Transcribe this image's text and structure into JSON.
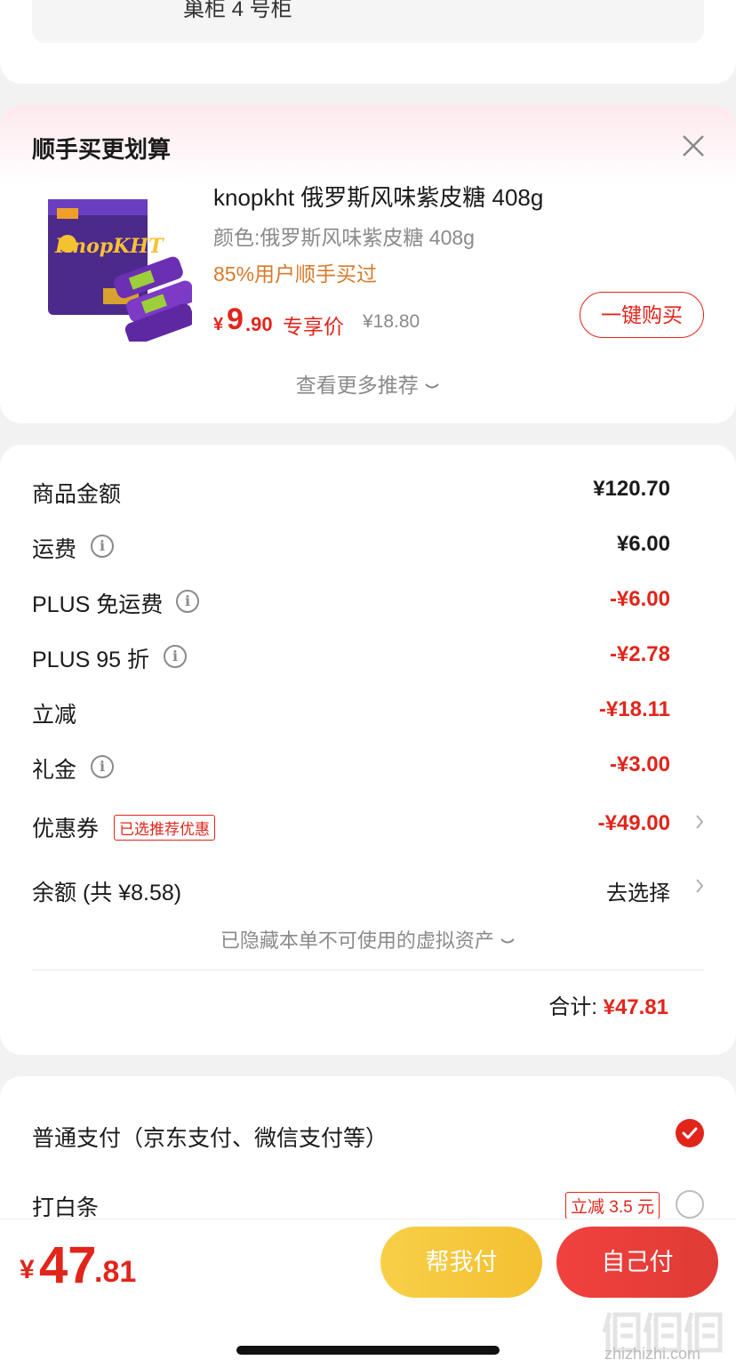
{
  "address": {
    "text": "巢柜 4 号柜"
  },
  "addon": {
    "title": "顺手买更划算",
    "product": {
      "name": "knopkht 俄罗斯风味紫皮糖 408g",
      "spec": "颜色:俄罗斯风味紫皮糖 408g",
      "bought": "85%用户顺手买过",
      "price_yen": "¥",
      "price_int": "9",
      "price_dec": ".90",
      "price_tag": "专享价",
      "original_price": "¥18.80",
      "image_brand_text": "KnopKHT"
    },
    "buy_button": "一键购买",
    "more": "查看更多推荐"
  },
  "amount": {
    "rows": [
      {
        "label": "商品金额",
        "value": "¥120.70"
      },
      {
        "label": "运费",
        "value": "¥6.00"
      },
      {
        "label": "PLUS 免运费",
        "value": "-¥6.00"
      },
      {
        "label": "PLUS 95 折",
        "value": "-¥2.78"
      },
      {
        "label": "立减",
        "value": "-¥18.11"
      },
      {
        "label": "礼金",
        "value": "-¥3.00"
      },
      {
        "label": "优惠券",
        "value": "-¥49.00",
        "badge": "已选推荐优惠"
      },
      {
        "label": "余额 (共 ¥8.58)",
        "value": "去选择"
      }
    ],
    "hidden_assets": "已隐藏本单不可使用的虚拟资产",
    "total_label": "合计:",
    "total_value": "¥47.81"
  },
  "payment": {
    "normal": "普通支付（京东支付、微信支付等）",
    "baitiao": "打白条",
    "baitiao_badge": "立减 3.5 元"
  },
  "bottom": {
    "yen": "¥",
    "int": "47",
    "dec": ".81",
    "help_pay": "帮我付",
    "self_pay": "自己付"
  },
  "watermark": "zhizhizhi.com",
  "colors": {
    "accent": "#e1251b",
    "yellow": "#f5c83c",
    "orange": "#d97a2b"
  }
}
